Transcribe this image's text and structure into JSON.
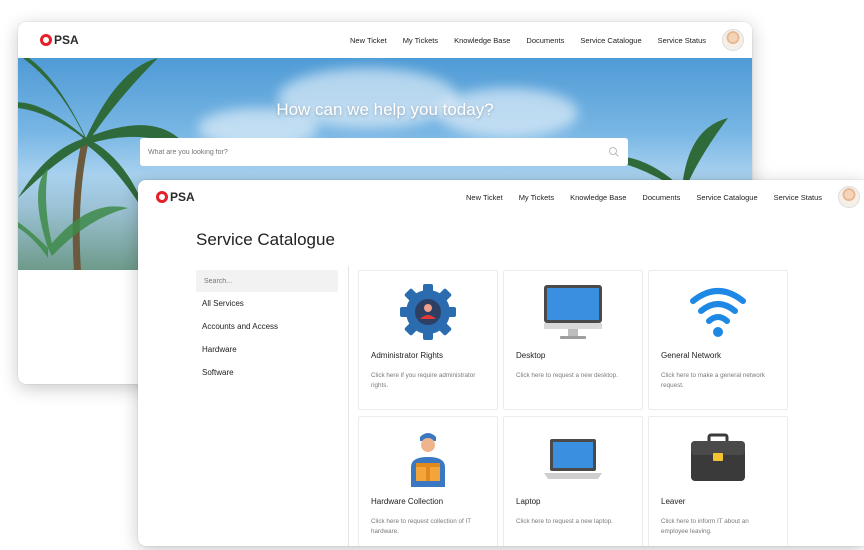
{
  "back_window": {
    "logo": {
      "text": "PSA"
    },
    "nav": [
      "New Ticket",
      "My Tickets",
      "Knowledge Base",
      "Documents",
      "Service Catalogue",
      "Service Status"
    ],
    "hero": {
      "title": "How can we help you today?",
      "search_placeholder": "What are you looking for?"
    }
  },
  "front_window": {
    "logo": {
      "text": "PSA"
    },
    "nav": [
      "New Ticket",
      "My Tickets",
      "Knowledge Base",
      "Documents",
      "Service Catalogue",
      "Service Status"
    ],
    "page_title": "Service Catalogue",
    "sidebar": {
      "search_placeholder": "Search...",
      "items": [
        "All Services",
        "Accounts and Access",
        "Hardware",
        "Software"
      ]
    },
    "cards": [
      {
        "icon": "gear-user-icon",
        "title": "Administrator Rights",
        "desc": "Click here if you require administrator rights."
      },
      {
        "icon": "desktop-icon",
        "title": "Desktop",
        "desc": "Click here to request a new desktop."
      },
      {
        "icon": "wifi-icon",
        "title": "General Network",
        "desc": "Click here to make a general network request."
      },
      {
        "icon": "delivery-person-icon",
        "title": "Hardware Collection",
        "desc": "Click here to request collection of IT hardware."
      },
      {
        "icon": "laptop-icon",
        "title": "Laptop",
        "desc": "Click here to request a new laptop."
      },
      {
        "icon": "briefcase-icon",
        "title": "Leaver",
        "desc": "Click here to inform IT about an employee leaving."
      }
    ]
  },
  "colors": {
    "brand_red": "#e4202a",
    "gear_blue": "#2b6cb0",
    "wifi_blue": "#1e88e5"
  }
}
